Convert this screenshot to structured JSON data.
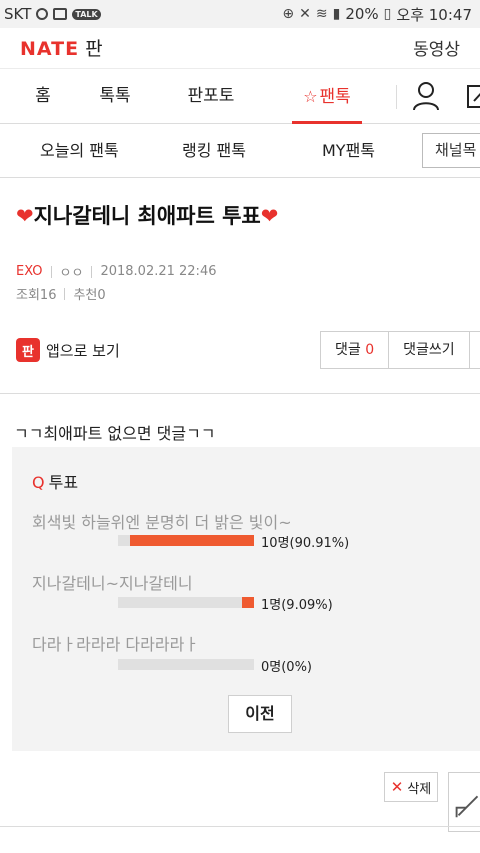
{
  "status_bar": {
    "carrier": "SKT",
    "battery": "20%",
    "time": "오후 10:47",
    "talk_badge": "TALK"
  },
  "header": {
    "logo_brand": "NATE",
    "logo_section": "판",
    "video_link": "동영상"
  },
  "main_nav": {
    "home": "홈",
    "toktok": "톡톡",
    "panphoto": "판포토",
    "fantalk": "팬톡"
  },
  "sub_nav": {
    "today": "오늘의 팬톡",
    "ranking": "랭킹 팬톡",
    "my": "MY팬톡",
    "channel": "채널목"
  },
  "article": {
    "title": "지나갈테니 최애파트 투표",
    "category": "EXO",
    "author": "ㅇㅇ",
    "date": "2018.02.21 22:46",
    "views": "조회16",
    "recommend": "추천0",
    "app_view": "앱으로 보기",
    "app_icon_glyph": "판",
    "comment_label": "댓글",
    "comment_count": "0",
    "write_comment": "댓글쓰기",
    "more": "·",
    "body": "ㄱㄱ최애파트 없으면 댓글ㄱㄱ"
  },
  "poll": {
    "q_label": "Q",
    "title": "투표",
    "options": [
      {
        "text": "회색빛 하늘위엔 분명히 더 밝은 빛이~",
        "result": "10명(90.91%)",
        "fraction": 0.9091
      },
      {
        "text": "지나갈테니~지나갈테니",
        "result": "1명(9.09%)",
        "fraction": 0.0909
      },
      {
        "text": "다라ㅏ라라라 다라라라ㅏ",
        "result": "0명(0%)",
        "fraction": 0
      }
    ],
    "prev_button": "이전"
  },
  "footer": {
    "delete_button": "삭제"
  },
  "colors": {
    "brand": "#e8322d",
    "poll_bar": "#ef5a30"
  }
}
